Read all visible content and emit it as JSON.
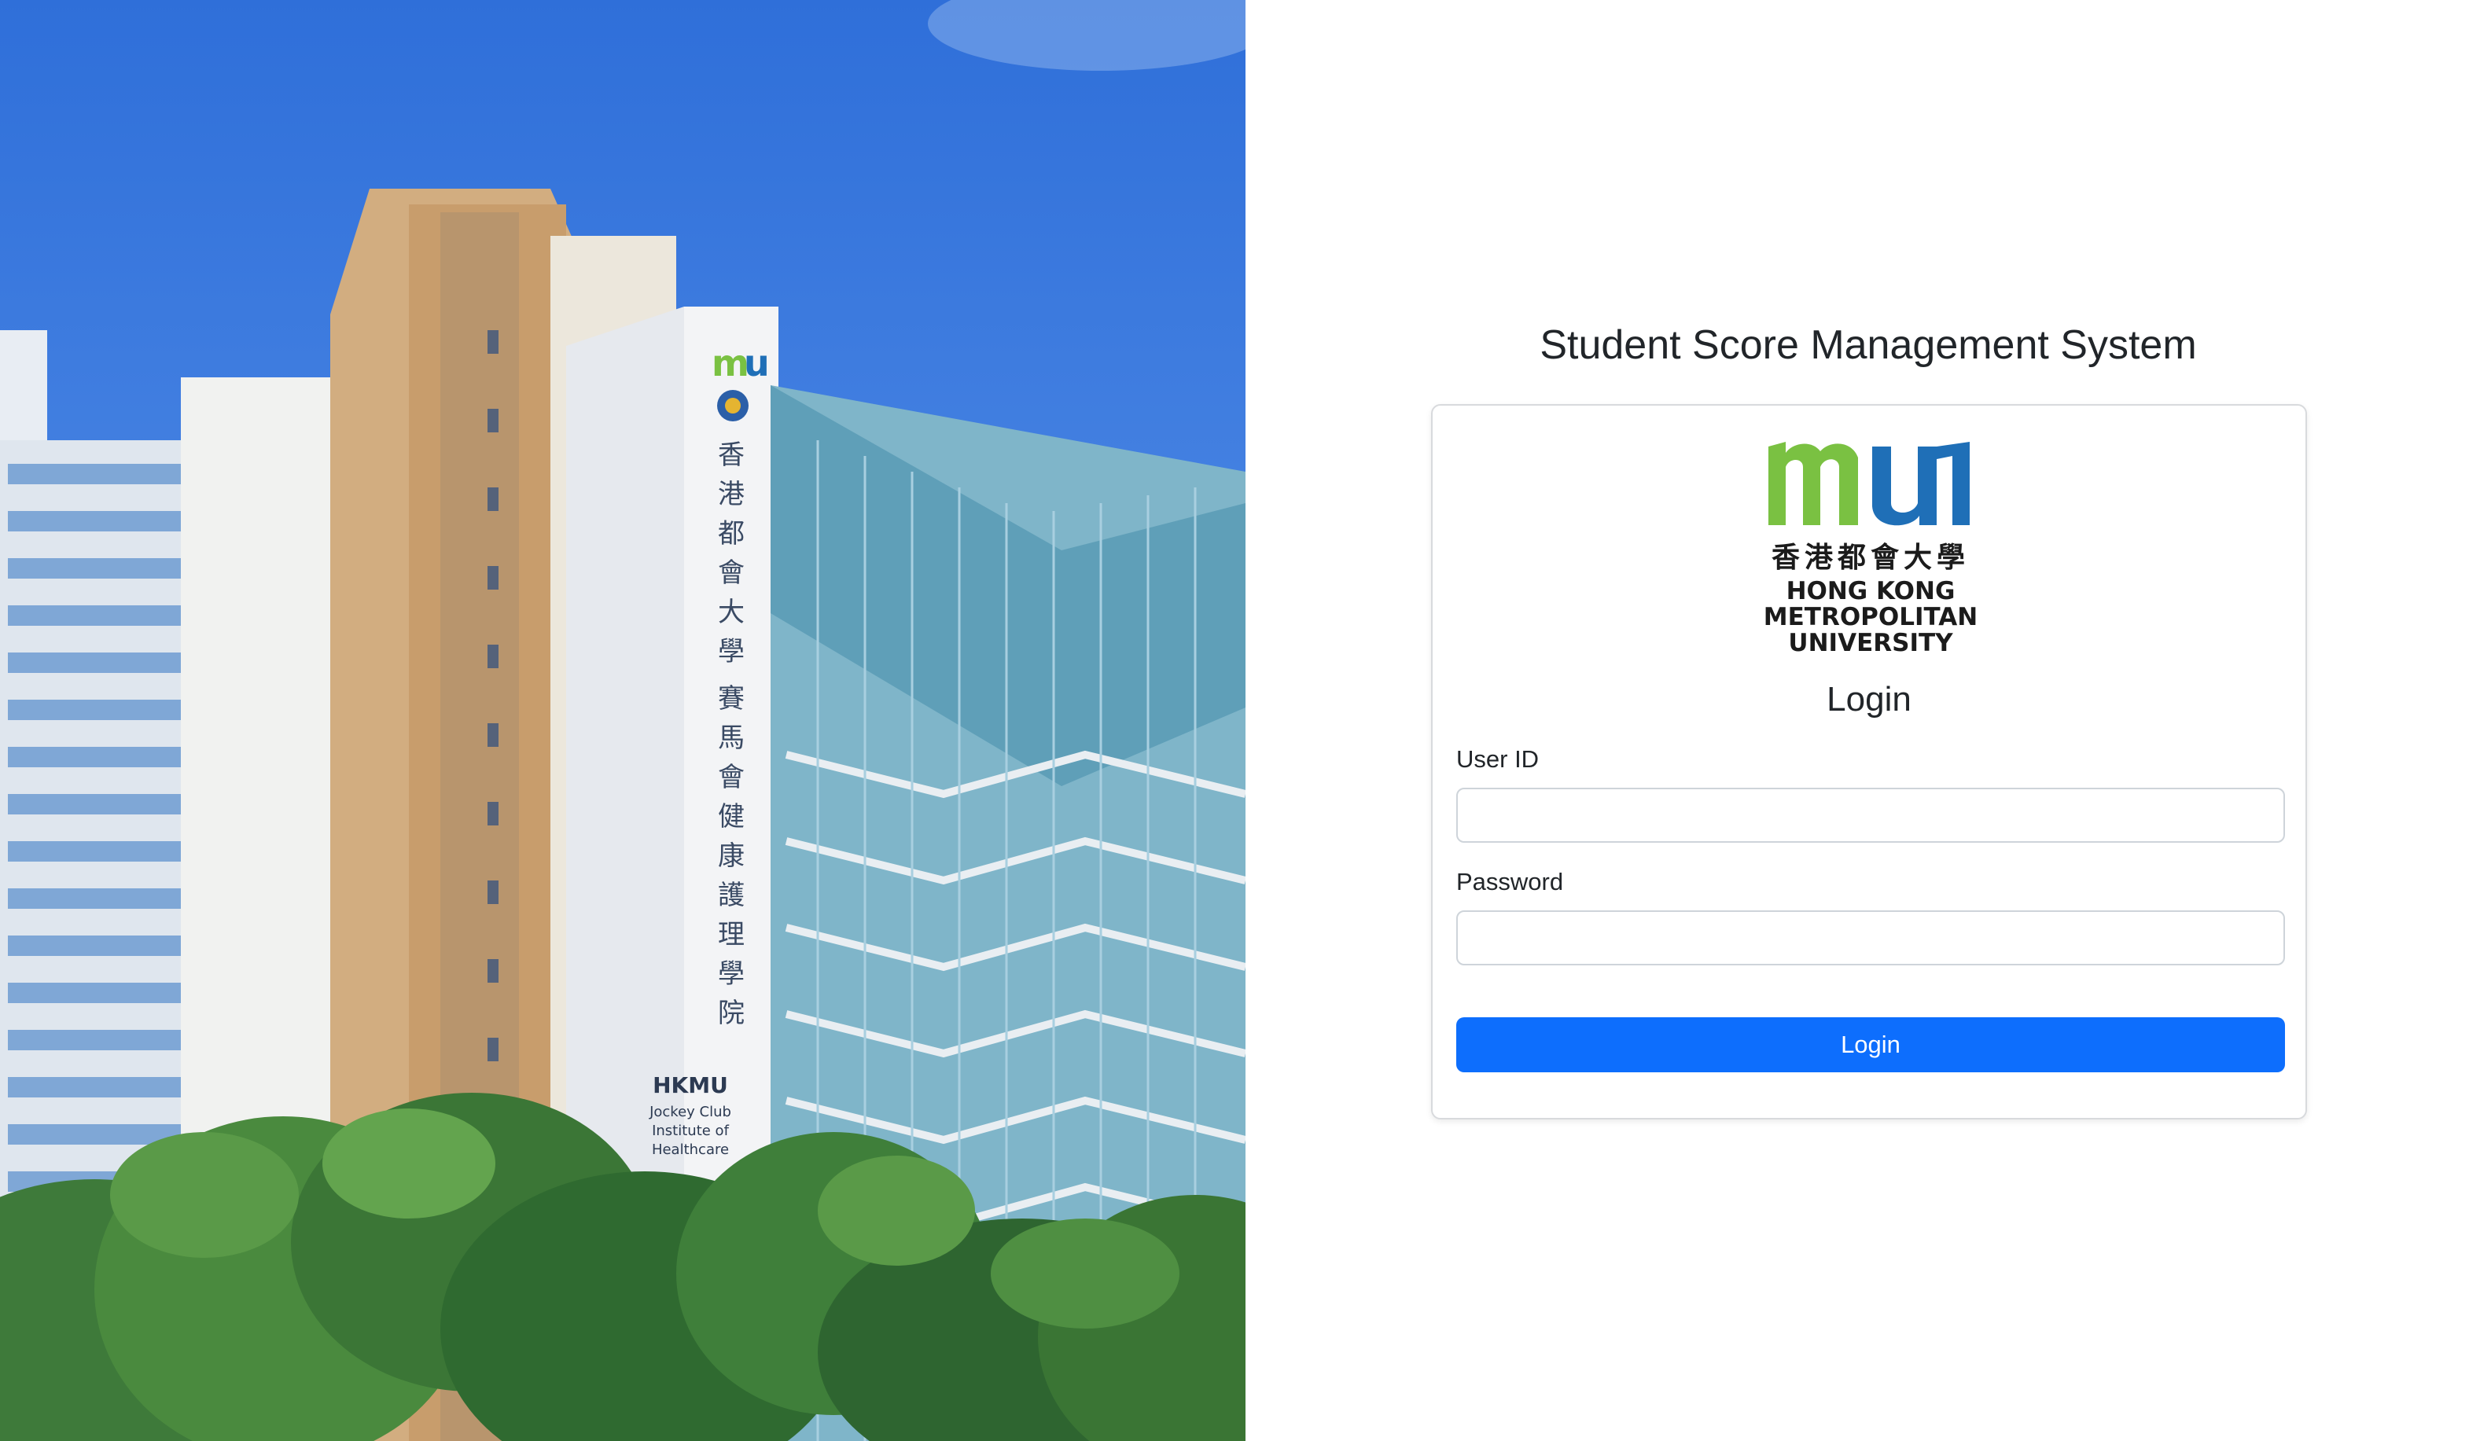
{
  "photo": {
    "building_sign_chinese": "香港都會大學賽馬會健康護理學院",
    "building_sign_english": [
      "HKMU",
      "Jockey Club",
      "Institute of",
      "Healthcare"
    ],
    "building_logo": "mu"
  },
  "header": {
    "title": "Student Score Management System"
  },
  "logo": {
    "mark": "mu",
    "chinese_name": "香港都會大學",
    "english_lines": [
      "HONG KONG",
      "METROPOLITAN",
      "UNIVERSITY"
    ],
    "colors": {
      "green": "#7ac142",
      "blue": "#1f6fb7"
    }
  },
  "login": {
    "heading": "Login",
    "user_id_label": "User ID",
    "user_id_value": "",
    "password_label": "Password",
    "password_value": "",
    "submit_label": "Login"
  },
  "colors": {
    "primary": "#0d6efd",
    "card_border": "#d8dadd",
    "input_border": "#ced4da"
  }
}
